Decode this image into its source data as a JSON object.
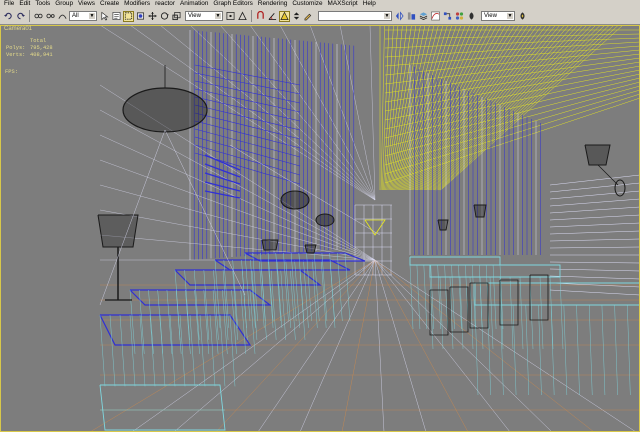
{
  "menu": [
    "File",
    "Edit",
    "Tools",
    "Group",
    "Views",
    "Create",
    "Modifiers",
    "reactor",
    "Animation",
    "Graph Editors",
    "Rendering",
    "Customize",
    "MAXScript",
    "Help"
  ],
  "toolbar": {
    "selection_filter": "All",
    "coord_system": "View",
    "named_selection": "",
    "render_type": "View"
  },
  "viewport": {
    "label": "Camera01",
    "stats_header": "Total",
    "polys_label": "Polys:",
    "polys_value": "795,428",
    "verts_label": "Verts:",
    "verts_value": "408,941",
    "fps_label": "FPS:"
  },
  "colors": {
    "background": "#7d7d7d",
    "wire_blue": "#2f2fd6",
    "wire_cyan": "#7fd8e0",
    "wire_yellow": "#e8e820",
    "wire_white": "#dcdcf4",
    "wire_orange": "#d08a4a",
    "wire_black": "#1a1a1a"
  }
}
